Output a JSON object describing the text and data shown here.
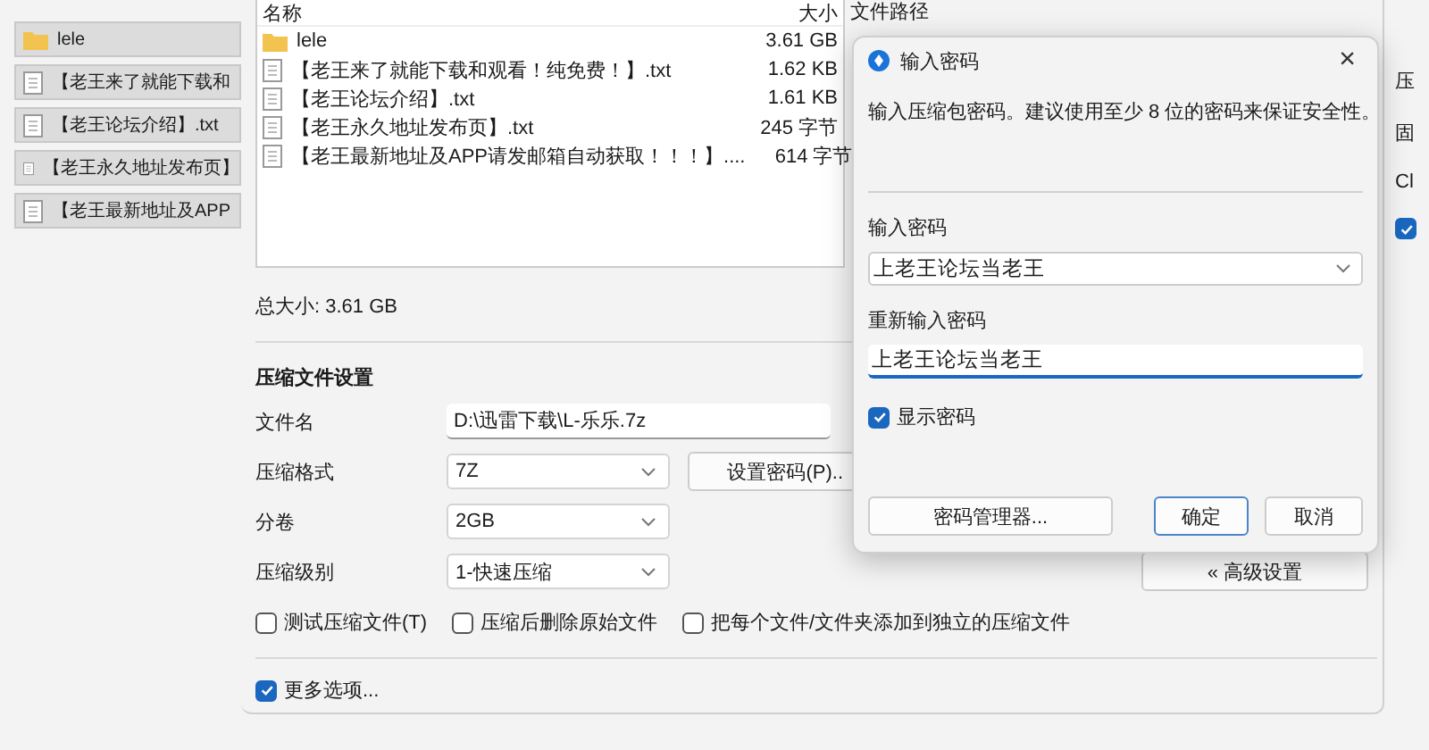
{
  "background_list": {
    "items": [
      {
        "kind": "folder",
        "label": "lele"
      },
      {
        "kind": "file",
        "label": "【老王来了就能下载和"
      },
      {
        "kind": "file",
        "label": "【老王论坛介绍】.txt"
      },
      {
        "kind": "file",
        "label": "【老王永久地址发布页】"
      },
      {
        "kind": "file",
        "label": "【老王最新地址及APP"
      }
    ]
  },
  "main": {
    "file_table": {
      "columns": [
        "名称",
        "大小",
        "文件路径"
      ],
      "rows": [
        {
          "kind": "folder",
          "name": "lele",
          "size": "3.61 GB"
        },
        {
          "kind": "file",
          "name": "【老王来了就能下载和观看！纯免费！】.txt",
          "size": "1.62 KB"
        },
        {
          "kind": "file",
          "name": "【老王论坛介绍】.txt",
          "size": "1.61 KB"
        },
        {
          "kind": "file",
          "name": "【老王永久地址发布页】.txt",
          "size": "245 字节"
        },
        {
          "kind": "file",
          "name": "【老王最新地址及APP请发邮箱自动获取！！！】....",
          "size": "614 字节"
        }
      ]
    },
    "total_size": "总大小: 3.61 GB",
    "section_title": "压缩文件设置",
    "filename": {
      "label": "文件名",
      "value": "D:\\迅雷下载\\L-乐乐.7z"
    },
    "format": {
      "label": "压缩格式",
      "value": "7Z"
    },
    "set_password_button": "设置密码(P)..",
    "volume": {
      "label": "分卷",
      "value": "2GB"
    },
    "level": {
      "label": "压缩级别",
      "value": "1-快速压缩"
    },
    "advanced_button": "« 高级设置",
    "options": [
      {
        "label": "测试压缩文件(T)",
        "checked": false
      },
      {
        "label": "压缩后删除原始文件",
        "checked": false
      },
      {
        "label": "把每个文件/文件夹添加到独立的压缩文件",
        "checked": false
      }
    ],
    "more_options": {
      "label": "更多选项...",
      "checked": true
    }
  },
  "side_panel": {
    "labels": [
      "压",
      "固",
      "Cl"
    ],
    "checkbox": {
      "checked": true
    }
  },
  "password_dialog": {
    "title": "输入密码",
    "close": "×",
    "description": "输入压缩包密码。建议使用至少 8 位的密码来保证安全性。",
    "password": {
      "label": "输入密码",
      "value": "上老王论坛当老王"
    },
    "confirm": {
      "label": "重新输入密码",
      "value": "上老王论坛当老王"
    },
    "show_password": {
      "label": "显示密码",
      "checked": true
    },
    "buttons": [
      {
        "kind": "secondary",
        "label": "密码管理器..."
      },
      {
        "kind": "default",
        "label": "确定"
      },
      {
        "kind": "normal",
        "label": "取消"
      }
    ]
  }
}
